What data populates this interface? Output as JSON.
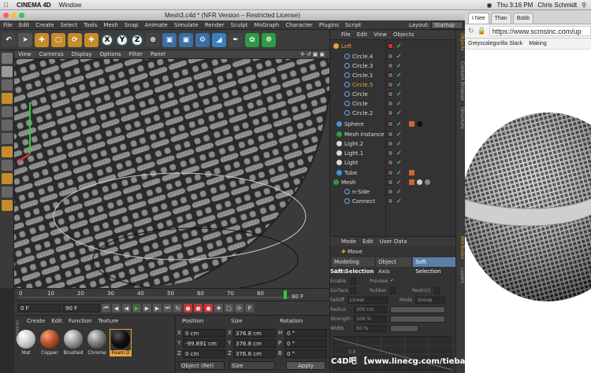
{
  "mac_menubar": {
    "app": "CINEMA 4D",
    "menu": "Window",
    "time": "Thu 3:16 PM",
    "user": "Chris Schmidt"
  },
  "window": {
    "title": "Mesh3.c4d * (NFR Version – Restricted License)"
  },
  "menu": {
    "items": [
      "File",
      "Edit",
      "Create",
      "Select",
      "Tools",
      "Mesh",
      "Snap",
      "Animate",
      "Simulate",
      "Render",
      "Sculpt",
      "MoGraph",
      "Character",
      "Plugins",
      "Script"
    ],
    "layout_label": "Layout:",
    "layout_value": "Startup"
  },
  "toolbar": {
    "x_label": "X",
    "y_label": "Y",
    "z_label": "Z"
  },
  "viewport_menu": [
    "View",
    "Cameras",
    "Display",
    "Options",
    "Filter",
    "Panel"
  ],
  "object_manager": {
    "menu": [
      "File",
      "Edit",
      "View",
      "Objects"
    ],
    "objects": [
      {
        "name": "Loft",
        "color": "#e8a33a"
      },
      {
        "name": "Circle.4",
        "color": "#ddd"
      },
      {
        "name": "Circle.3",
        "color": "#ddd"
      },
      {
        "name": "Circle.1",
        "color": "#ddd"
      },
      {
        "name": "Circle.5",
        "color": "#e8a33a"
      },
      {
        "name": "Circle",
        "color": "#ddd"
      },
      {
        "name": "Circle",
        "color": "#ddd"
      },
      {
        "name": "Circle.2",
        "color": "#ddd"
      },
      {
        "name": "Sphere",
        "color": "#ddd"
      },
      {
        "name": "Mesh Instance",
        "color": "#ddd"
      },
      {
        "name": "Light.2",
        "color": "#ddd"
      },
      {
        "name": "Light.1",
        "color": "#ddd"
      },
      {
        "name": "Light",
        "color": "#ddd"
      },
      {
        "name": "Tube",
        "color": "#ddd"
      },
      {
        "name": "Mesh",
        "color": "#ddd"
      },
      {
        "name": "n-Side",
        "color": "#ddd"
      },
      {
        "name": "Connect",
        "color": "#ddd"
      }
    ]
  },
  "right_tabs": [
    "Objects",
    "Content Browser",
    "Structure",
    "Attributes",
    "Layers"
  ],
  "attributes": {
    "menu": [
      "Mode",
      "Edit",
      "User Data"
    ],
    "title": "Move",
    "tabs": [
      "Modeling Axis",
      "Object Axis",
      "Soft Selection"
    ],
    "section": "Soft Selection",
    "enable": "Enable",
    "preview": "Preview",
    "surface": "Surface",
    "rubber": "Rubber",
    "restrict": "Restrict",
    "falloff": "Falloff",
    "falloff_value": "Linear",
    "mode": "Mode",
    "mode_value": "Group",
    "radius": "Radius",
    "radius_value": "100 cm",
    "strength": "Strength",
    "strength_value": "100 %",
    "width": "Width",
    "width_value": "50 %",
    "graph_label": "0.8"
  },
  "timeline": {
    "ticks": [
      "0",
      "10",
      "20",
      "30",
      "40",
      "50",
      "60",
      "70",
      "80",
      "90"
    ],
    "end_frame": "90 F"
  },
  "playbar": {
    "start": "0 F",
    "end": "90 F"
  },
  "materials": {
    "menu": [
      "Create",
      "Edit",
      "Function",
      "Texture"
    ],
    "items": [
      {
        "name": "Mat",
        "color": "#cfcfcf"
      },
      {
        "name": "Copper",
        "color": "#b5522c"
      },
      {
        "name": "Brushed",
        "color": "#999"
      },
      {
        "name": "Chrome",
        "color": "#888"
      },
      {
        "name": "Foam D",
        "color": "#111"
      }
    ],
    "brand": "CINEMA4D"
  },
  "coordinates": {
    "headers": [
      "Position",
      "Size",
      "Rotation"
    ],
    "rows": [
      {
        "axis": "X",
        "pos": "0 cm",
        "size_axis": "X",
        "size": "376.8 cm",
        "rot_axis": "H",
        "rot": "0 °"
      },
      {
        "axis": "Y",
        "pos": "-99.891 cm",
        "size_axis": "Y",
        "size": "376.8 cm",
        "rot_axis": "P",
        "rot": "0 °"
      },
      {
        "axis": "Z",
        "pos": "0 cm",
        "size_axis": "Z",
        "size": "376.8 cm",
        "rot_axis": "B",
        "rot": "0 °"
      }
    ],
    "mode1": "Object (Rel)",
    "mode2": "Size",
    "apply": "Apply"
  },
  "browser": {
    "tabs": [
      "I Nee",
      "Than",
      "Bobb"
    ],
    "url": "https://www.scmsinc.com/up",
    "bookmarks": [
      "Greyscalegorilla Slack",
      "Making"
    ]
  },
  "watermark": "C4D吧  【www.linecg.com/tieba/1799】"
}
